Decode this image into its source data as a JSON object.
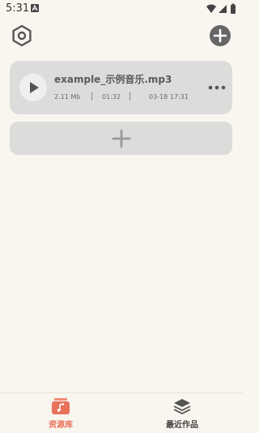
{
  "status_bar": {
    "time": "5:31"
  },
  "header": {
    "settings_icon": "hexagon-settings-icon",
    "add_icon": "add-circle-icon"
  },
  "files": [
    {
      "name": "example_示例音乐.mp3",
      "size": "2.11 Mb",
      "duration": "01:32",
      "date": "03-18 17:31"
    }
  ],
  "add_card": {
    "icon": "plus-icon"
  },
  "bottom_nav": {
    "items": [
      {
        "label": "资源库",
        "icon": "music-library-icon",
        "active": true
      },
      {
        "label": "最近作品",
        "icon": "layers-icon",
        "active": false
      }
    ]
  },
  "colors": {
    "background": "#f9f6ef",
    "card": "#dcdcdb",
    "accent": "#e8725a",
    "icon_dark": "#666666"
  }
}
